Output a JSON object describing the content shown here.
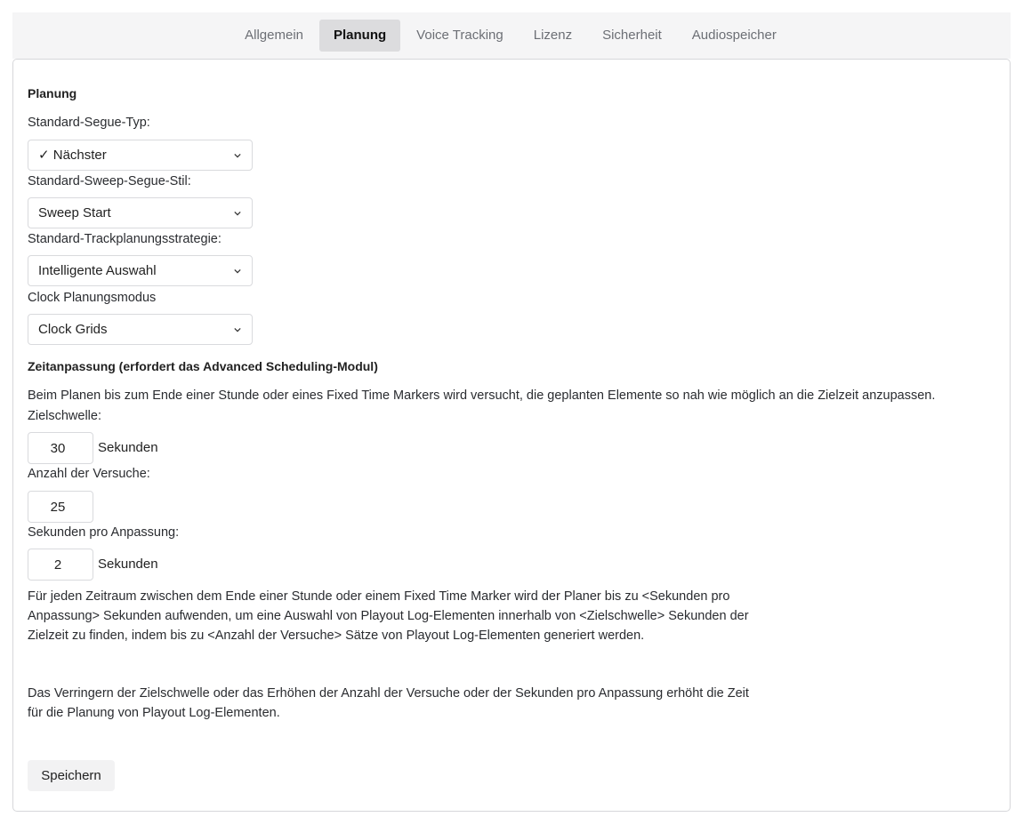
{
  "tabs": [
    {
      "label": "Allgemein"
    },
    {
      "label": "Planung",
      "active": true
    },
    {
      "label": "Voice Tracking"
    },
    {
      "label": "Lizenz"
    },
    {
      "label": "Sicherheit"
    },
    {
      "label": "Audiospeicher"
    }
  ],
  "planning": {
    "title": "Planung",
    "segue_type": {
      "label": "Standard-Segue-Typ:",
      "value": "✓ Nächster"
    },
    "sweep_segue": {
      "label": "Standard-Sweep-Segue-Stil:",
      "value": "Sweep Start"
    },
    "track_strategy": {
      "label": "Standard-Trackplanungsstrategie:",
      "value": "Intelligente Auswahl"
    },
    "clock_mode": {
      "label": "Clock Planungsmodus",
      "value": "Clock Grids"
    }
  },
  "time_adjust": {
    "title": "Zeitanpassung (erfordert das Advanced Scheduling-Modul)",
    "description": "Beim Planen bis zum Ende einer Stunde oder eines Fixed Time Markers wird versucht, die geplanten Elemente so nah wie möglich an die Zielzeit anzupassen.",
    "threshold": {
      "label": "Zielschwelle:",
      "value": "30",
      "unit": "Sekunden"
    },
    "attempts": {
      "label": "Anzahl der Versuche:",
      "value": "25"
    },
    "seconds_per_adjust": {
      "label": "Sekunden pro Anpassung:",
      "value": "2",
      "unit": "Sekunden"
    },
    "explanation_1": "Für jeden Zeitraum zwischen dem Ende einer Stunde oder einem Fixed Time Marker wird der Planer bis zu <Sekunden pro Anpassung> Sekunden aufwenden, um eine Auswahl von Playout Log-Elementen innerhalb von <Zielschwelle> Sekunden der Zielzeit zu finden, indem bis zu <Anzahl der Versuche> Sätze von Playout Log-Elementen generiert werden.",
    "explanation_2": "Das Verringern der Zielschwelle oder das Erhöhen der Anzahl der Versuche oder der Sekunden pro Anpassung erhöht die Zeit für die Planung von Playout Log-Elementen."
  },
  "save_label": "Speichern",
  "icons": {
    "select_chevron": "chevron-down-icon"
  }
}
